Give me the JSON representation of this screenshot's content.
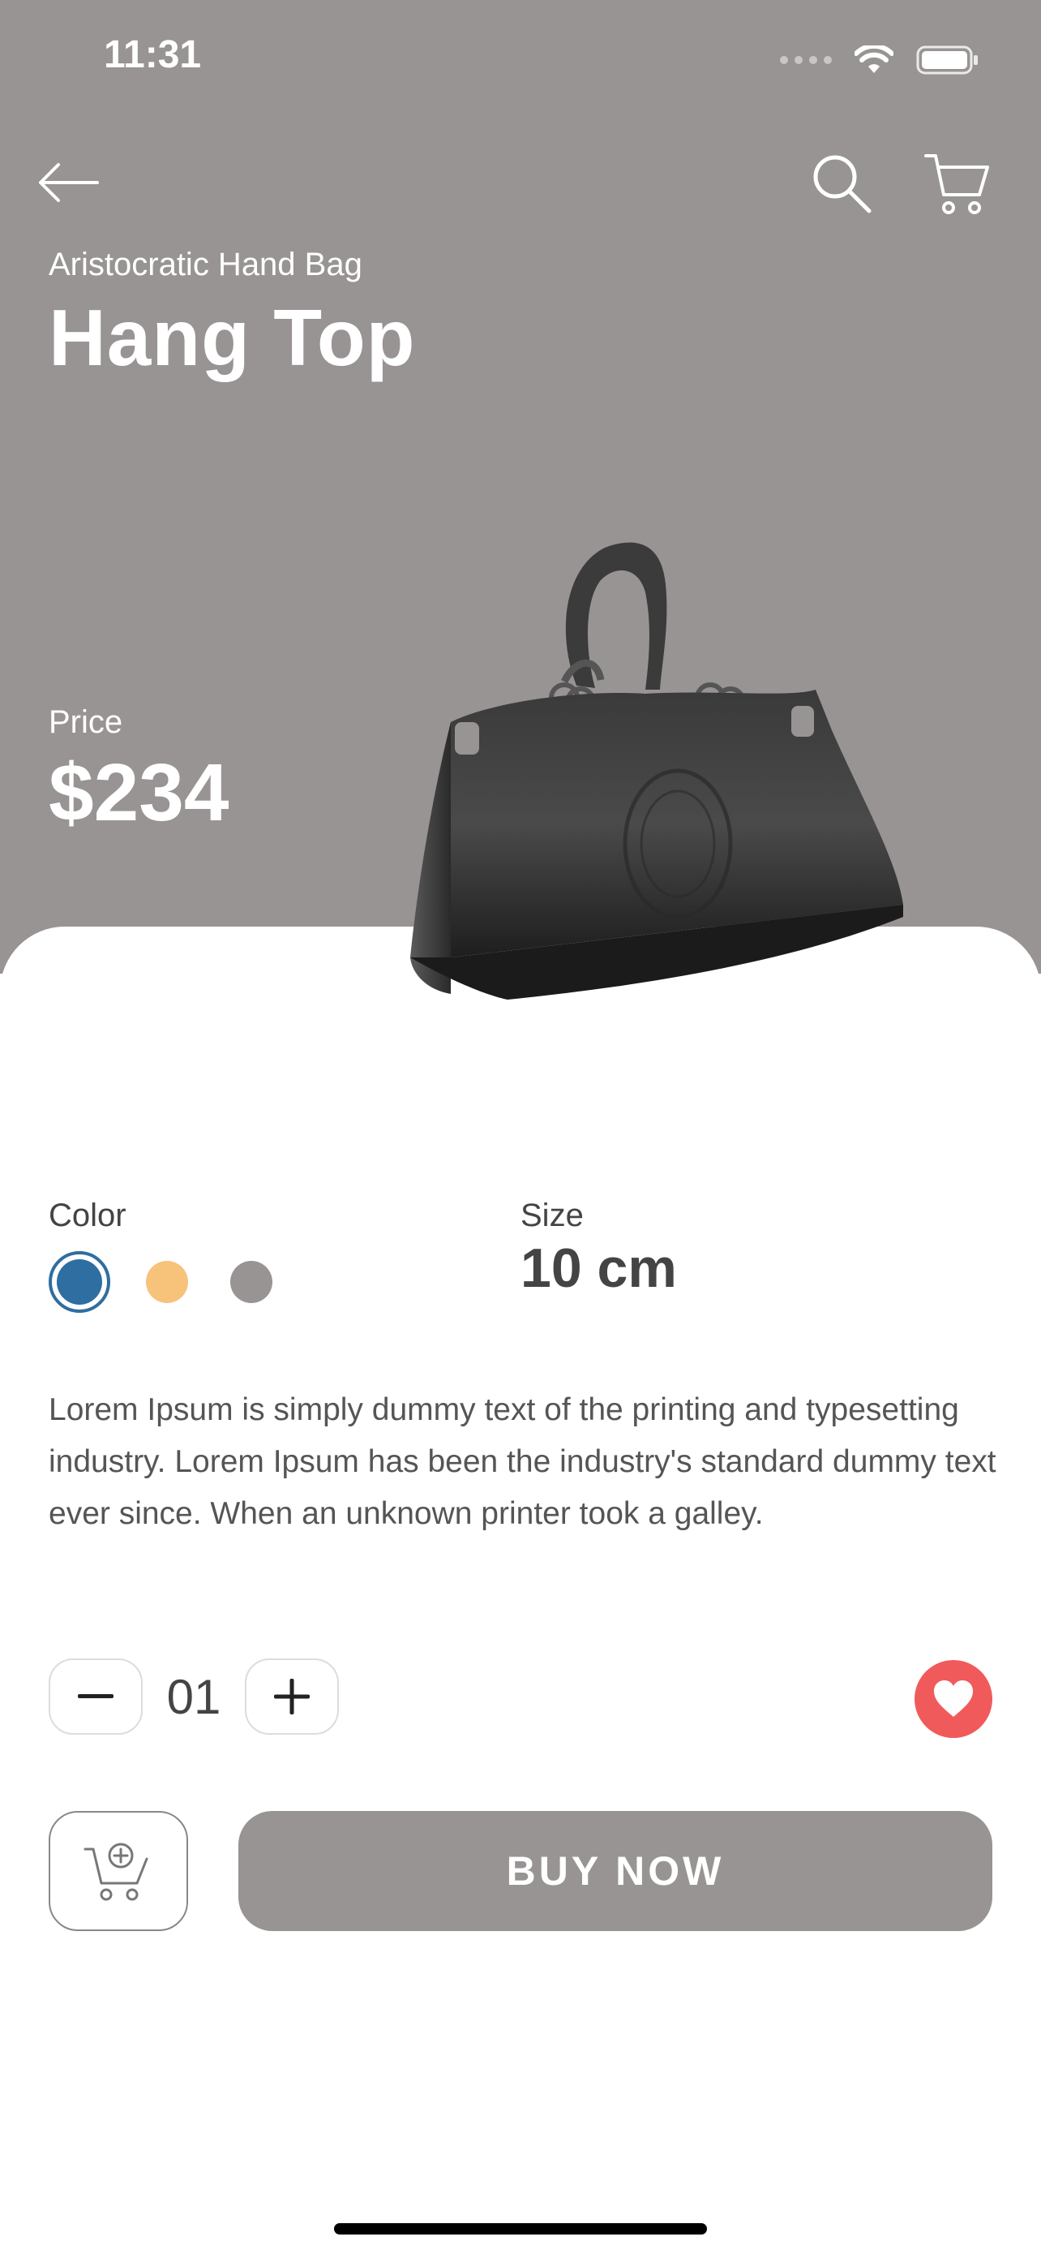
{
  "status_bar": {
    "time": "11:31"
  },
  "nav": {
    "back_icon": "arrow-left-icon",
    "search_icon": "search-icon",
    "cart_icon": "cart-icon"
  },
  "product": {
    "subtitle": "Aristocratic Hand Bag",
    "title": "Hang Top",
    "price_label": "Price",
    "price": "$234",
    "image_name": "black-handbag"
  },
  "options": {
    "color_label": "Color",
    "colors": [
      "#2f6ea0",
      "#f7c27a",
      "#989493"
    ],
    "selected_color": "#2f6ea0",
    "size_label": "Size",
    "size_value": "10 cm"
  },
  "description": "Lorem Ipsum is simply dummy text of the printing and typesetting industry. Lorem Ipsum has been the industry's standard dummy text ever since. When an unknown printer took a galley.",
  "quantity": {
    "value": "01",
    "minus_icon": "minus-icon",
    "plus_icon": "plus-icon"
  },
  "favorite": {
    "icon": "heart-icon",
    "color": "#f15a5a"
  },
  "actions": {
    "add_to_cart_icon": "cart-plus-icon",
    "buy_label": "BUY  NOW"
  },
  "theme": {
    "hero_bg": "#989493",
    "accent": "#989493"
  }
}
